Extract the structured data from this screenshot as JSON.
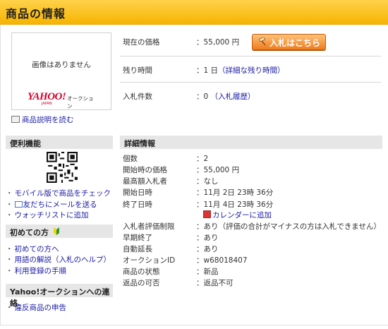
{
  "header": {
    "title": "商品の情報"
  },
  "image": {
    "no_image_text": "画像はありません",
    "logo_main": "YAHOO!",
    "logo_japan": "JAPAN",
    "logo_auction": "オークション"
  },
  "description_link": "商品説明を読む",
  "price": {
    "label": "現在の価格",
    "value": "55,000 円",
    "bid_button": "入札はこちら"
  },
  "time_left": {
    "label": "残り時間",
    "value": "1 日",
    "link": "（詳細な残り時間）"
  },
  "bids": {
    "label": "入札件数",
    "value": "0",
    "link": "（入札履歴）"
  },
  "sidebar": {
    "convenient": {
      "title": "便利機能",
      "links": [
        "モバイル版で商品をチェック",
        "友だちにメールを送る",
        "ウォッチリストに追加"
      ]
    },
    "first_time": {
      "title": "初めての方",
      "links": [
        "初めての方へ",
        "用語の解説（入札のヘルプ）",
        "利用登録の手順"
      ]
    },
    "contact": {
      "title": "Yahoo!オークションへの連絡",
      "links": [
        "違反商品の申告"
      ]
    }
  },
  "details": {
    "title": "詳細情報",
    "rows": [
      {
        "label": "個数",
        "value": "2"
      },
      {
        "label": "開始時の価格",
        "value": "55,000 円"
      },
      {
        "label": "最高額入札者",
        "value": "なし"
      },
      {
        "label": "開始日時",
        "value": "11月 2日 23時 36分"
      },
      {
        "label": "終了日時",
        "value": "11月 4日 23時 36分"
      },
      {
        "label": "",
        "value": "カレンダーに追加"
      },
      {
        "label": "入札者評価制限",
        "value": "あり（評価の合計がマイナスの方は入札できません）"
      },
      {
        "label": "早期終了",
        "value": "あり"
      },
      {
        "label": "自動延長",
        "value": "あり"
      },
      {
        "label": "オークションID",
        "value": "w68018407"
      },
      {
        "label": "商品の状態",
        "value": "新品"
      },
      {
        "label": "返品の可否",
        "value": "返品不可"
      }
    ]
  },
  "colors": {
    "header": "#f6b400",
    "link": "#1a1aa6",
    "button": "#ef7b1c",
    "logo": "#d4002b"
  }
}
